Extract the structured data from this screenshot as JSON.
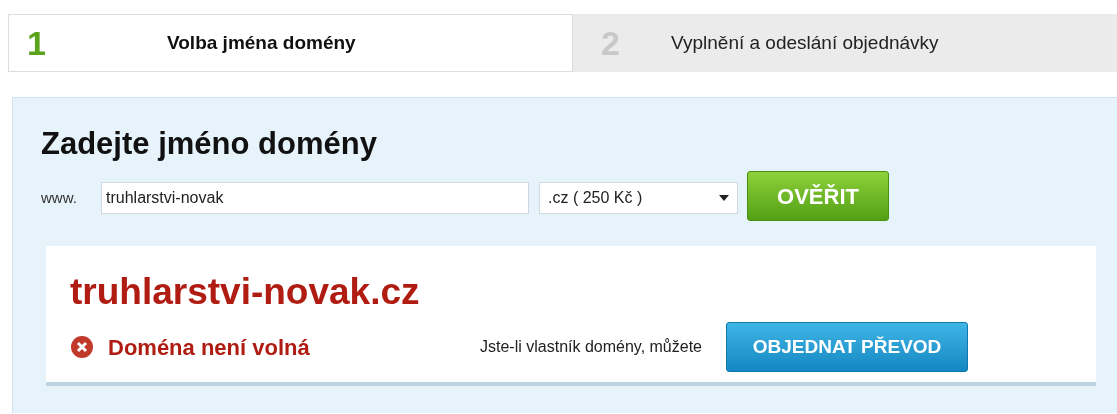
{
  "steps": [
    {
      "number": "1",
      "label": "Volba jména domény",
      "selected": true
    },
    {
      "number": "2",
      "label": "Vyplnění a odeslání objednávky",
      "selected": false
    }
  ],
  "heading": "Zadejte jméno domény",
  "form": {
    "prefix": "www.",
    "domain_value": "truhlarstvi-novak",
    "tld_value": ".cz ( 250 Kč )",
    "submit": "OVĚŘIT"
  },
  "result": {
    "domain": "truhlarstvi-novak.cz",
    "available": false,
    "status": "Doména není volná",
    "hint": "Jste-li vlastník domény, můžete",
    "action": "OBJEDNAT PŘEVOD"
  }
}
